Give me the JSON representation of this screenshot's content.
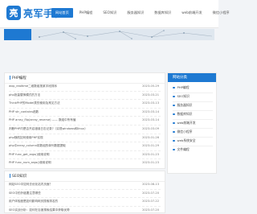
{
  "logo": {
    "mark": "亮",
    "text": "亮军手札"
  },
  "nav": [
    "网站首页",
    "PHP编程",
    "SEO知识",
    "服务器知识",
    "数据库知识",
    "web前端开发",
    "微信小程序"
  ],
  "sections": [
    {
      "title": "PHP编程",
      "rows": [
        {
          "title": "wxp_realtime二维数组按某字段排序",
          "date": "2023-05-29"
        },
        {
          "title": "php批量替换模式的方法",
          "date": "2023-03-21"
        },
        {
          "title": "ThinkPHP的Model类的使用及常见方法",
          "date": "2023-03-13"
        },
        {
          "title": "PHP str_contains函数",
          "date": "2023-03-14"
        },
        {
          "title": "PHP array_flip(array_reverse) —— 数组中所有值",
          "date": "2023-03-14"
        },
        {
          "title": "判断PHP内是否开启错误日志记录?（实现windows和linux）",
          "date": "2023-03-09"
        },
        {
          "title": "php随机如何使用PHP实现",
          "date": "2023-01-26"
        },
        {
          "title": "php中array_column将数组的单列数据提取",
          "date": "2023-01-29"
        },
        {
          "title": "PHP func_get_args()使用说明",
          "date": "2023-01-23"
        },
        {
          "title": "PHP func_num_args()使用说明",
          "date": "2023-01-23"
        }
      ]
    },
    {
      "title": "SEO知识",
      "rows": [
        {
          "title": "网站SEO中如何去优化站内页面？",
          "date": "2023-08-13"
        },
        {
          "title": "SEO中的外链要注意哪些",
          "date": "2023-07-20"
        },
        {
          "title": "用户体验度是如何影响网页搜索排名的",
          "date": "2023-07-22"
        },
        {
          "title": "SEO实战分析：如何在百度搜索结果中获取优势",
          "date": "2023-07-20"
        }
      ]
    }
  ],
  "sidebar": {
    "title": "网站分类",
    "items": [
      "PHP编程",
      "SEO知识",
      "服务器知识",
      "数据库知识",
      "web前端开发",
      "微信小程序",
      "web系统安全",
      "文件编程"
    ]
  }
}
